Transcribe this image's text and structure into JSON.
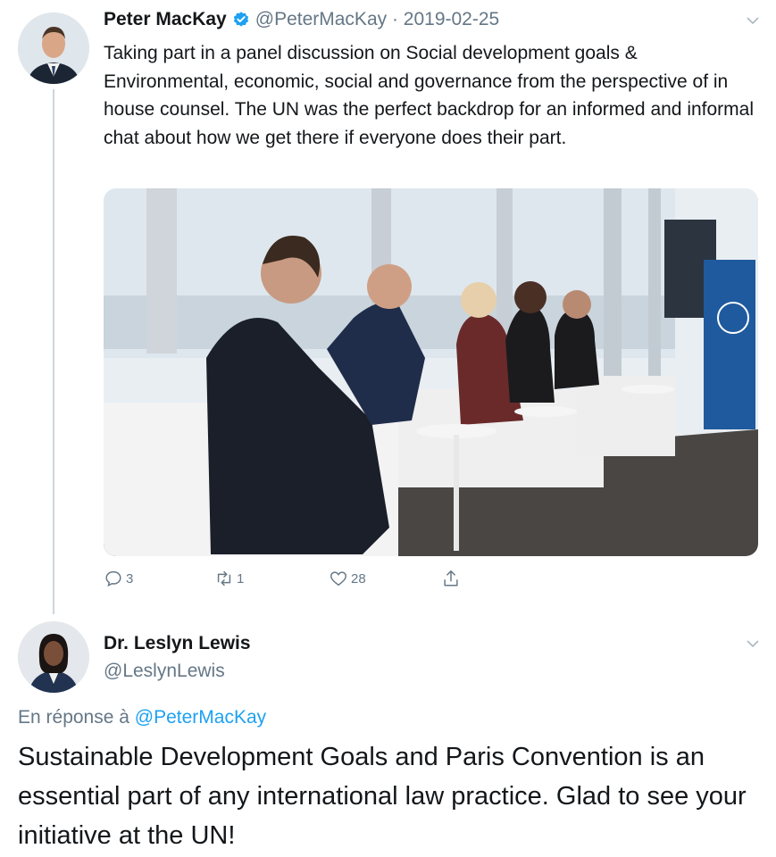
{
  "tweet": {
    "author_name": "Peter MacKay",
    "verified_icon": "verified-badge-icon",
    "handle_date": "@PeterMacKay · 2019-02-25",
    "text": "Taking part in a panel discussion on Social development goals & Environmental, economic, social and governance from the perspective of in house counsel. The UN was the perfect backdrop for an informed and informal chat about how we get there if everyone does their part.",
    "actions": {
      "reply_count": "3",
      "retweet_count": "1",
      "like_count": "28"
    }
  },
  "reply": {
    "author_name": "Dr. Leslyn Lewis",
    "handle": "@LeslynLewis",
    "reply_prefix": "En réponse à",
    "reply_to_handle": "@PeterMacKay",
    "text": "Sustainable Development Goals and Paris Convention is an essential part of any international law practice. Glad to see your initiative at the UN!"
  },
  "colors": {
    "text": "#14171a",
    "secondary": "#657786",
    "accent": "#1da1f2",
    "thread_line": "#ccd6dd"
  }
}
